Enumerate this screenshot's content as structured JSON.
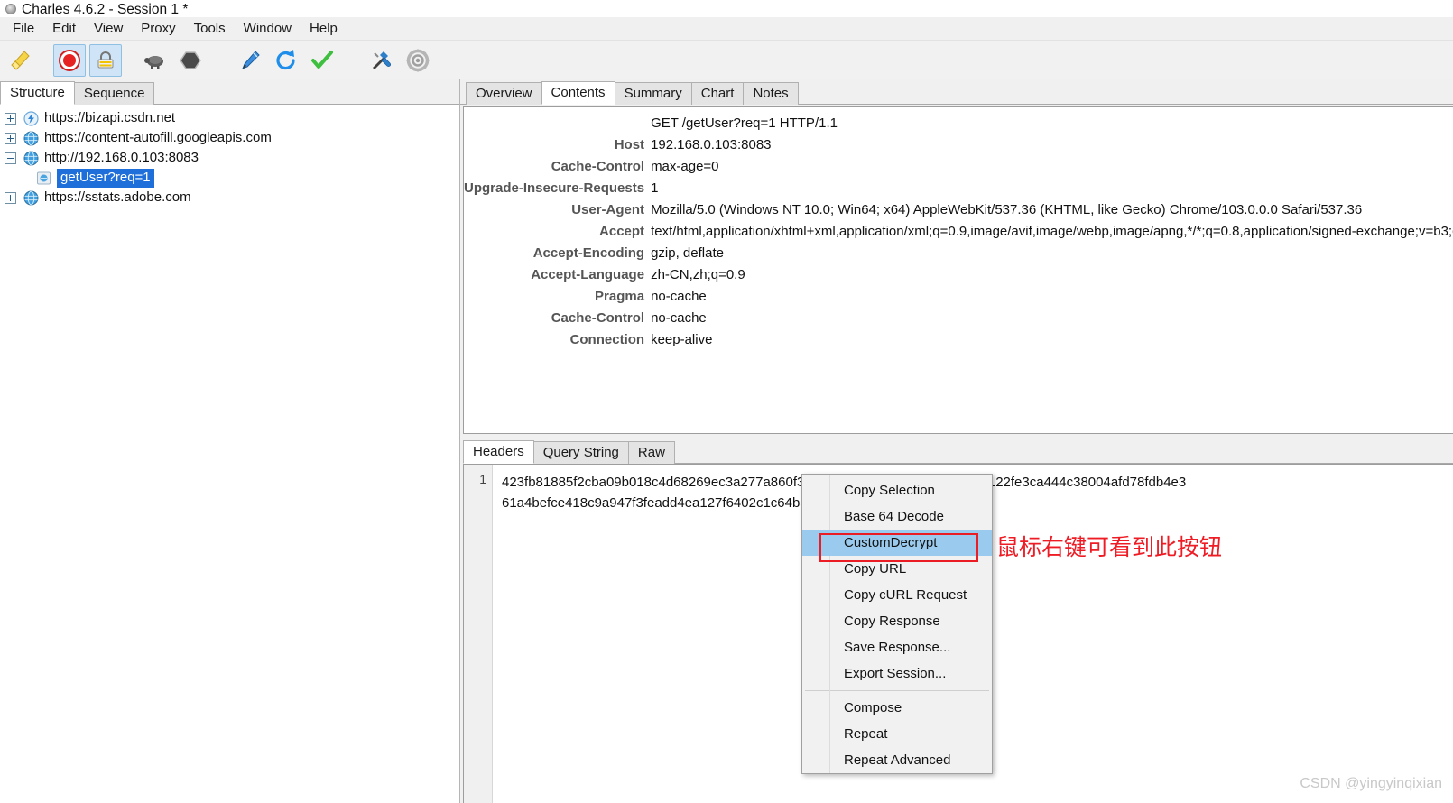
{
  "window": {
    "title": "Charles 4.6.2 - Session 1 *",
    "app_icon": "charles-bottle-icon"
  },
  "menubar": {
    "items": [
      {
        "label": "File",
        "name": "menu-file"
      },
      {
        "label": "Edit",
        "name": "menu-edit"
      },
      {
        "label": "View",
        "name": "menu-view"
      },
      {
        "label": "Proxy",
        "name": "menu-proxy"
      },
      {
        "label": "Tools",
        "name": "menu-tools"
      },
      {
        "label": "Window",
        "name": "menu-window"
      },
      {
        "label": "Help",
        "name": "menu-help"
      }
    ]
  },
  "toolbar": {
    "buttons": [
      {
        "name": "clear-session-icon",
        "title": "Clear Session",
        "active": false
      },
      {
        "name": "record-icon",
        "title": "Start/Stop Recording",
        "active": true
      },
      {
        "name": "ssl-proxying-icon",
        "title": "SSL Proxying",
        "active": true
      },
      {
        "name": "throttle-icon",
        "title": "Throttle Settings",
        "active": false
      },
      {
        "name": "breakpoints-icon",
        "title": "Breakpoints",
        "active": false
      },
      {
        "name": "compose-icon",
        "title": "Compose",
        "active": false
      },
      {
        "name": "repeat-icon",
        "title": "Repeat",
        "active": false
      },
      {
        "name": "validate-icon",
        "title": "Validate",
        "active": false
      },
      {
        "name": "tools-icon",
        "title": "Tools",
        "active": false
      },
      {
        "name": "settings-gear-icon",
        "title": "Settings",
        "active": false
      }
    ]
  },
  "left_pane": {
    "tabs": [
      {
        "label": "Structure",
        "selected": true
      },
      {
        "label": "Sequence",
        "selected": false
      }
    ],
    "tree": [
      {
        "label": "https://bizapi.csdn.net",
        "expander": "plus",
        "icon": "lightning-host-icon",
        "level": 0,
        "selected": false
      },
      {
        "label": "https://content-autofill.googleapis.com",
        "expander": "plus",
        "icon": "globe-host-icon",
        "level": 0,
        "selected": false
      },
      {
        "label": "http://192.168.0.103:8083",
        "expander": "minus",
        "icon": "globe-host-icon",
        "level": 0,
        "selected": false
      },
      {
        "label": "getUser?req=1",
        "expander": "none",
        "icon": "request-doc-icon",
        "level": 1,
        "selected": true
      },
      {
        "label": "https://sstats.adobe.com",
        "expander": "plus",
        "icon": "globe-host-icon",
        "level": 0,
        "selected": false
      }
    ]
  },
  "right_pane": {
    "tabs": [
      {
        "label": "Overview",
        "selected": false
      },
      {
        "label": "Contents",
        "selected": true
      },
      {
        "label": "Summary",
        "selected": false
      },
      {
        "label": "Chart",
        "selected": false
      },
      {
        "label": "Notes",
        "selected": false
      }
    ],
    "request_line": "GET /getUser?req=1 HTTP/1.1",
    "headers": [
      {
        "name": "Host",
        "value": "192.168.0.103:8083"
      },
      {
        "name": "Cache-Control",
        "value": "max-age=0"
      },
      {
        "name": "Upgrade-Insecure-Requests",
        "value": "1"
      },
      {
        "name": "User-Agent",
        "value": "Mozilla/5.0 (Windows NT 10.0; Win64; x64) AppleWebKit/537.36 (KHTML, like Gecko) Chrome/103.0.0.0 Safari/537.36"
      },
      {
        "name": "Accept",
        "value": "text/html,application/xhtml+xml,application/xml;q=0.9,image/avif,image/webp,image/apng,*/*;q=0.8,application/signed-exchange;v=b3;q=0.9"
      },
      {
        "name": "Accept-Encoding",
        "value": "gzip, deflate"
      },
      {
        "name": "Accept-Language",
        "value": "zh-CN,zh;q=0.9"
      },
      {
        "name": "Pragma",
        "value": "no-cache"
      },
      {
        "name": "Cache-Control",
        "value": "no-cache"
      },
      {
        "name": "Connection",
        "value": "keep-alive"
      }
    ],
    "lower_tabs": [
      {
        "label": "Headers",
        "selected": true
      },
      {
        "label": "Query String",
        "selected": false
      },
      {
        "label": "Raw",
        "selected": false
      }
    ],
    "content": {
      "line_number": "1",
      "line1": "423fb81885f2cba09b018c4d68269ec3a277a860f34406993031267fc8f406fd4258122fe3ca444c38004afd78fdb4e3",
      "line2": "61a4befce418c9a947f3feadd4ea127f6402c1c64b5"
    }
  },
  "context_menu": {
    "items": [
      {
        "label": "Copy Selection",
        "highlight": false,
        "separator_after": false
      },
      {
        "label": "Base 64 Decode",
        "highlight": false,
        "separator_after": false
      },
      {
        "label": "CustomDecrypt",
        "highlight": true,
        "separator_after": false
      },
      {
        "label": "Copy URL",
        "highlight": false,
        "separator_after": false
      },
      {
        "label": "Copy cURL Request",
        "highlight": false,
        "separator_after": false
      },
      {
        "label": "Copy Response",
        "highlight": false,
        "separator_after": false
      },
      {
        "label": "Save Response...",
        "highlight": false,
        "separator_after": false
      },
      {
        "label": "Export Session...",
        "highlight": false,
        "separator_after": true
      },
      {
        "label": "Compose",
        "highlight": false,
        "separator_after": false
      },
      {
        "label": "Repeat",
        "highlight": false,
        "separator_after": false
      },
      {
        "label": "Repeat Advanced",
        "highlight": false,
        "separator_after": false
      }
    ]
  },
  "annotation": {
    "text": "鼠标右键可看到此按钮",
    "color": "#ee1c24"
  },
  "watermark": {
    "text": "CSDN @yingyinqixian",
    "color": "#c8c8c8"
  },
  "colors": {
    "highlight_blue": "#9acbee",
    "selection_blue": "#1e6fd9",
    "toolbar_active": "#cfe5f7",
    "red_accent": "#ec1c24"
  }
}
